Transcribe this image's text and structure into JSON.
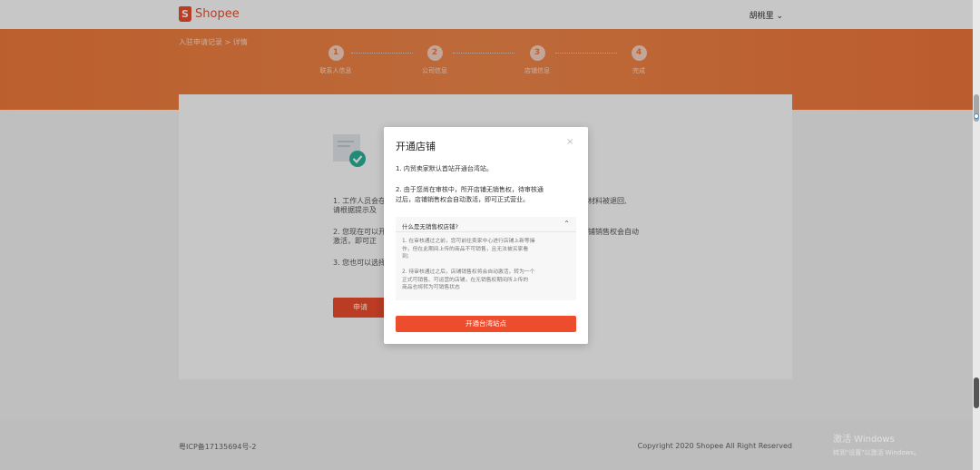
{
  "header": {
    "brand": "Shopee",
    "brand_glyph": "S",
    "user": "胡桃里 ⌄"
  },
  "breadcrumb": "入驻申请记录 > 详情",
  "steps": [
    {
      "num": "1",
      "label": "联系人信息"
    },
    {
      "num": "2",
      "label": "公司信息"
    },
    {
      "num": "3",
      "label": "店铺信息"
    },
    {
      "num": "4",
      "label": "完成"
    }
  ],
  "content": {
    "line1a": "1.  工作人员会在",
    "line1b": "    请根据提示及",
    "line1c": "材料被退回,",
    "line2a": "2.  您现在可以开",
    "line2b": "    激活，即可正",
    "line2c": "铺销售权会自动",
    "line3a": "3.  您也可以选择",
    "apply_label": "申请"
  },
  "footer": {
    "icp": "粤ICP备17135694号-2",
    "copyright": "Copyright 2020 Shopee All Right Reserved"
  },
  "modal": {
    "title": "开通店铺",
    "close": "×",
    "item1": "1.  内贸卖家默认首站开通台湾站。",
    "item2a": "2.  由于您尚在审核中，所开店铺无销售权，待审核通",
    "item2b": "     过后，店铺销售权会自动激活，即可正式营业。",
    "faq": {
      "question": "什么是无销售权店铺?",
      "chevron": "⌃",
      "a1a": "1.   在审核通过之前，您可前往卖家中心进行店铺上新等操",
      "a1b": "      作，但在此期间上传的商品不可销售，且无法被买家看",
      "a1c": "      到;",
      "a2a": "2.   待审核通过之后，店铺销售权将会自动激活，转为一个",
      "a2b": "      正式可销售、可运营的店铺，在无销售权期间所上传的",
      "a2c": "      商品也将转为可销售状态"
    },
    "button": "开通台湾站点"
  },
  "watermark": {
    "line1": "激活 Windows",
    "line2": "转到\"设置\"以激活 Windows。"
  },
  "colors": {
    "accent": "#ee4d2d",
    "banner": "#f07a3b"
  }
}
